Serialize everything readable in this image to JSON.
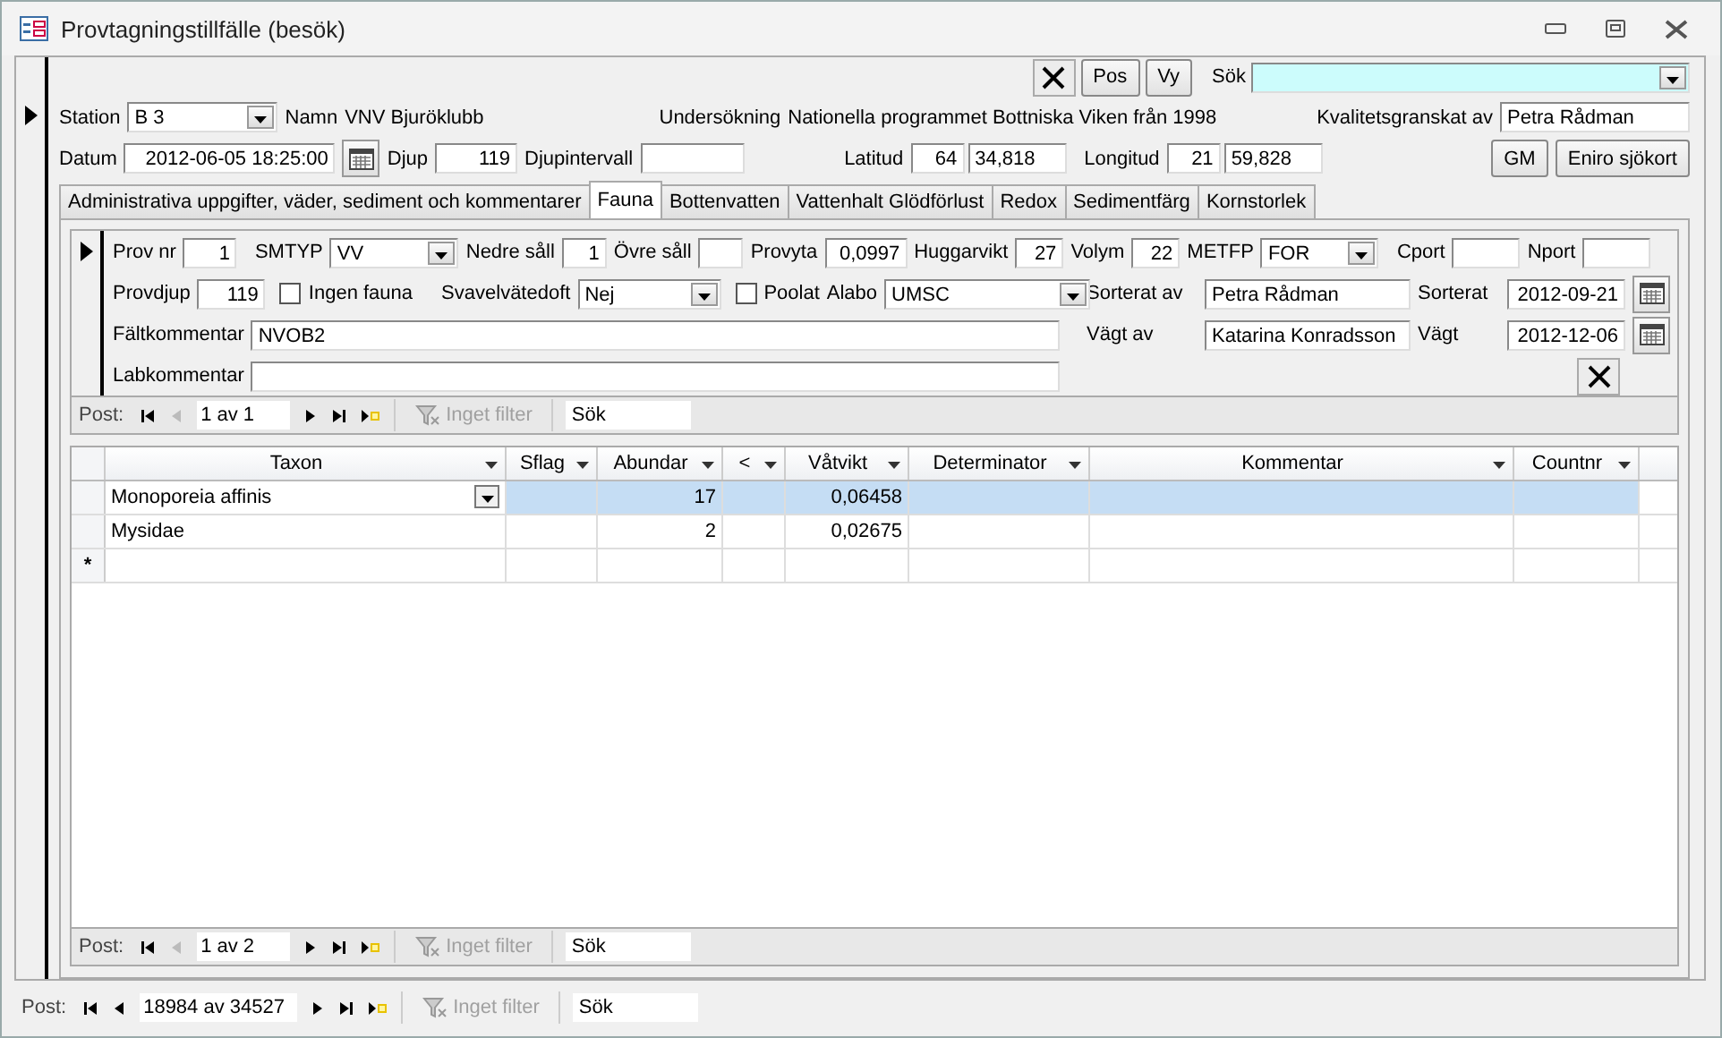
{
  "window": {
    "title": "Provtagningstillfälle (besök)"
  },
  "toolbar": {
    "buttons": [
      "Pos",
      "Vy"
    ],
    "search_label": "Sök"
  },
  "header": {
    "station": {
      "label": "Station",
      "value": "B 3"
    },
    "namn": {
      "label": "Namn",
      "value": "VNV Bjuröklubb"
    },
    "undersokning": {
      "label": "Undersökning",
      "value": "Nationella programmet Bottniska Viken från 1998"
    },
    "kvalitet": {
      "label": "Kvalitetsgranskat av",
      "value": "Petra Rådman"
    },
    "datum": {
      "label": "Datum",
      "value": "2012-06-05 18:25:00"
    },
    "djup": {
      "label": "Djup",
      "value": "119"
    },
    "djupintervall": {
      "label": "Djupintervall"
    },
    "latitud": {
      "label": "Latitud",
      "degrees": "64",
      "minutes": "34,818"
    },
    "longitud": {
      "label": "Longitud",
      "degrees": "21",
      "minutes": "59,828"
    },
    "buttons": [
      "GM",
      "Eniro sjökort"
    ]
  },
  "tabs": [
    {
      "label": "Administrativa uppgifter, väder, sediment och kommentarer",
      "selected": false
    },
    {
      "label": "Fauna",
      "selected": true
    },
    {
      "label": "Bottenvatten",
      "selected": false
    },
    {
      "label": "Vattenhalt Glödförlust",
      "selected": false
    },
    {
      "label": "Redox",
      "selected": false
    },
    {
      "label": "Sedimentfärg",
      "selected": false
    },
    {
      "label": "Kornstorlek",
      "selected": false
    }
  ],
  "sample": {
    "prov_nr": {
      "label": "Prov nr",
      "value": "1"
    },
    "smtyp": {
      "label": "SMTYP",
      "value": "VV"
    },
    "nedre_sall": {
      "label": "Nedre såll",
      "value": "1"
    },
    "ovre_sall": {
      "label": "Övre såll"
    },
    "provyta": {
      "label": "Provyta",
      "value": "0,0997"
    },
    "huggarvikt": {
      "label": "Huggarvikt",
      "value": "27"
    },
    "volym": {
      "label": "Volym",
      "value": "22"
    },
    "metfp": {
      "label": "METFP",
      "value": "FOR"
    },
    "cport": {
      "label": "Cport"
    },
    "nport": {
      "label": "Nport"
    },
    "provdjup": {
      "label": "Provdjup",
      "value": "119"
    },
    "ingen_fauna": {
      "label": "Ingen fauna",
      "checked": false
    },
    "svavelvatedoft": {
      "label": "Svavelvätedoft",
      "value": "Nej"
    },
    "poolat": {
      "label": "Poolat",
      "checked": false
    },
    "alabo": {
      "label": "Alabo",
      "value": "UMSC"
    },
    "sorterat_av": {
      "label": "Sorterat av",
      "value": "Petra Rådman"
    },
    "sorterat": {
      "label": "Sorterat",
      "value": "2012-09-21"
    },
    "faltkommentar": {
      "label": "Fältkommentar",
      "value": "NVOB2"
    },
    "vagt_av": {
      "label": "Vägt av",
      "value": "Katarina Konradsson"
    },
    "vagt": {
      "label": "Vägt",
      "value": "2012-12-06"
    },
    "labkommentar": {
      "label": "Labkommentar"
    }
  },
  "sample_nav": {
    "label": "Post:",
    "record": "1 av 1",
    "prev_disabled": true,
    "filter": "Inget filter",
    "filter_disabled": true,
    "search": "Sök"
  },
  "taxa": {
    "columns": [
      "Taxon",
      "Sflag",
      "Abundar",
      "<",
      "Våtvikt",
      "Determinator",
      "Kommentar",
      "Countnr"
    ],
    "rows": [
      {
        "selected": true,
        "cells": [
          "Monoporeia affinis",
          "",
          "17",
          "",
          "0,06458",
          "",
          "",
          ""
        ]
      },
      {
        "selected": false,
        "cells": [
          "Mysidae",
          "",
          "2",
          "",
          "0,02675",
          "",
          "",
          ""
        ]
      }
    ],
    "new_row_marker": "*"
  },
  "taxa_nav": {
    "label": "Post:",
    "record": "1 av 2",
    "prev_disabled": true,
    "filter": "Inget filter",
    "filter_disabled": true,
    "search": "Sök"
  },
  "main_nav": {
    "label": "Post:",
    "record": "18984 av 34527",
    "prev_disabled": false,
    "filter": "Inget filter",
    "filter_disabled": true,
    "search": "Sök"
  }
}
